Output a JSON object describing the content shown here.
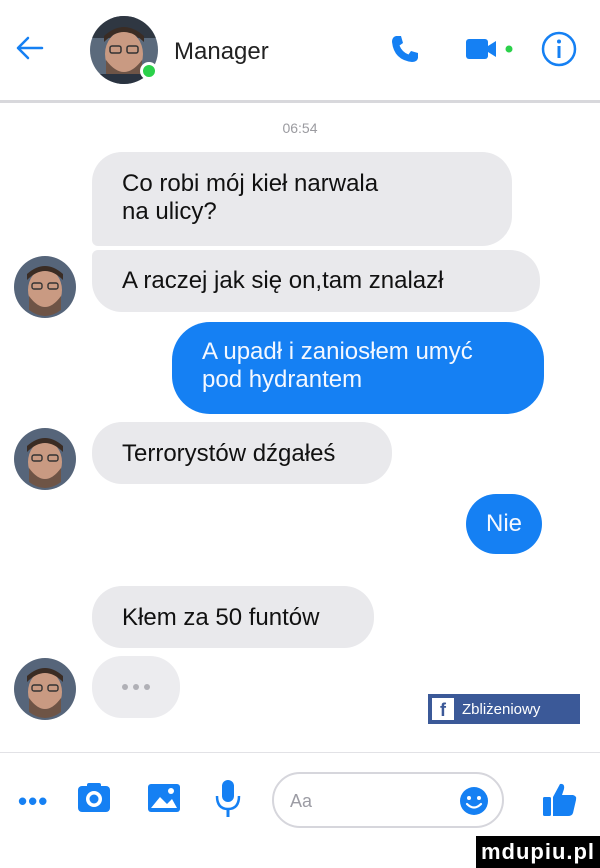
{
  "header": {
    "contact_name": "Manager",
    "icons": [
      "back-arrow-icon",
      "phone-icon",
      "video-camera-icon",
      "info-icon"
    ],
    "online_color": "#2bd14a"
  },
  "conversation": {
    "timestamp": "06:54",
    "messages": [
      {
        "side": "in",
        "line1": "Co robi mój kieł narwala",
        "line2": "na ulicy?"
      },
      {
        "side": "in",
        "text": "A raczej jak się on,tam znalazł"
      },
      {
        "side": "out",
        "line1": "A upadł i zaniosłem umyć",
        "line2": "pod hydrantem"
      },
      {
        "side": "in",
        "text": "Terrorystów dźgałeś"
      },
      {
        "side": "out",
        "text": "Nie"
      },
      {
        "side": "in",
        "text": "Kłem za 50 funtów"
      }
    ],
    "typing_indicator": true
  },
  "badge": {
    "text": "Zbliżeniowy",
    "letter": "f"
  },
  "composer": {
    "placeholder": "Aa",
    "icons": [
      "more-icon",
      "camera-icon",
      "gallery-icon",
      "microphone-icon",
      "emoji-icon",
      "thumbs-up-icon"
    ]
  },
  "watermark": "mdupiu.pl",
  "colors": {
    "accent": "#1580f3",
    "incoming_bubble": "#e9e9ec",
    "badge": "#3b5998"
  }
}
